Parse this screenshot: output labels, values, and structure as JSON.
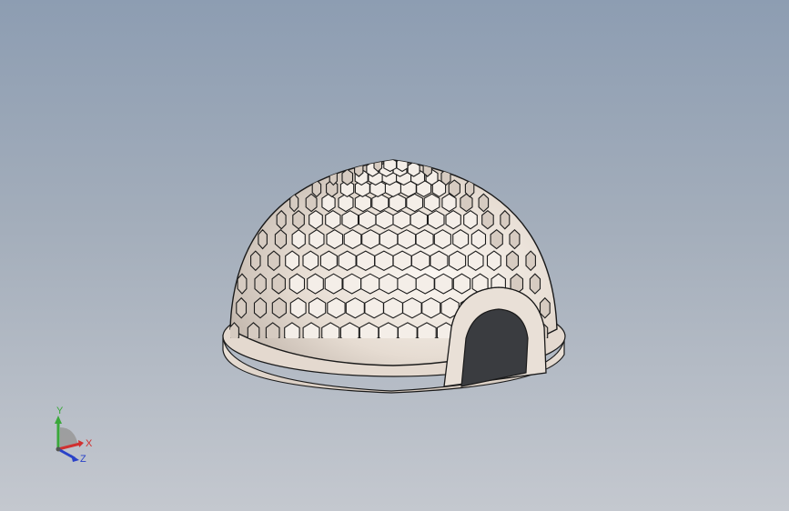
{
  "viewport": {
    "background_top": "#8d9db2",
    "background_bottom": "#c4c8cf"
  },
  "model": {
    "subject": "hexagon-pattern-dome-with-arched-entrance",
    "body_color": "#ece3da",
    "edge_color": "#1a1a1a",
    "opening_color": "#3a3c40"
  },
  "triad": {
    "x_label": "X",
    "y_label": "Y",
    "z_label": "Z",
    "x_color": "#d03030",
    "y_color": "#3aa83a",
    "z_color": "#2a42c8"
  }
}
